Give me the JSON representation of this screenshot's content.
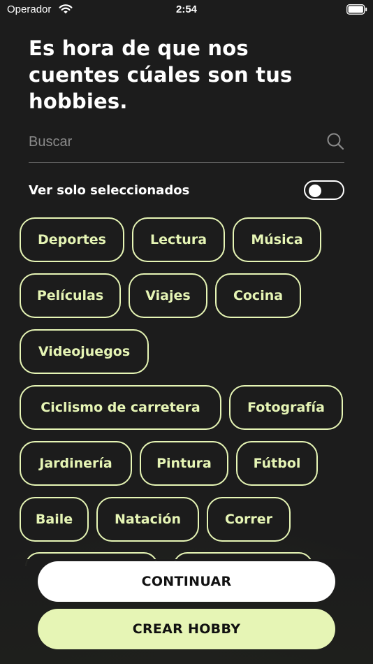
{
  "status_bar": {
    "carrier": "Operador",
    "time": "2:54"
  },
  "title": "Es hora de que nos cuentes cúales son tus hobbies.",
  "search": {
    "placeholder": "Buscar",
    "value": ""
  },
  "filter": {
    "label": "Ver solo seleccionados",
    "enabled": false
  },
  "hobbies": [
    "Deportes",
    "Lectura",
    "Música",
    "Películas",
    "Viajes",
    "Cocina",
    "Videojuegos",
    "Ciclismo de carretera",
    "Fotografía",
    "Jardinería",
    "Pintura",
    "Fútbol",
    "Baile",
    "Natación",
    "Correr"
  ],
  "buttons": {
    "continue": "CONTINUAR",
    "create_hobby": "CREAR HOBBY"
  },
  "colors": {
    "background": "#1c1c1c",
    "accent": "#e6f5b5",
    "primary_button": "#ffffff",
    "text": "#ffffff"
  }
}
